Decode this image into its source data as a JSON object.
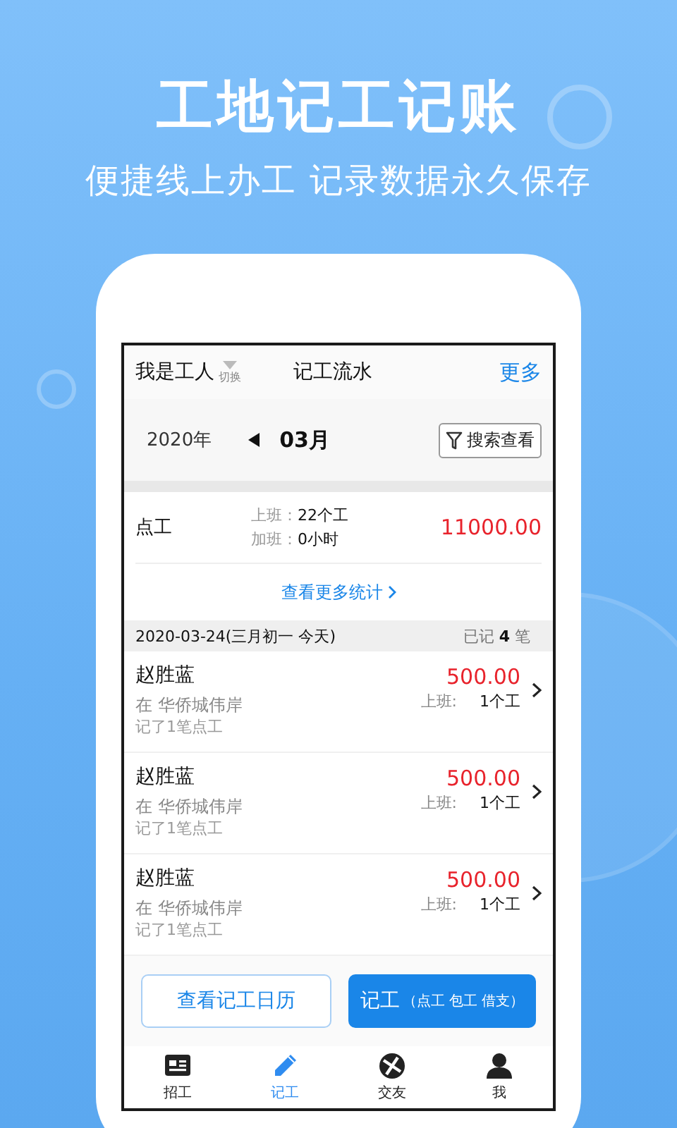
{
  "headline": "工地记工记账",
  "subheadline": "便捷线上办工 记录数据永久保存",
  "app": {
    "header": {
      "role": "我是工人",
      "switch": "切换",
      "title": "记工流水",
      "more": "更多"
    },
    "date_bar": {
      "year": "2020年",
      "month": "03月",
      "search": "搜索查看"
    },
    "summary": {
      "type": "点工",
      "rows": [
        {
          "label": "上班：",
          "value": "22个工"
        },
        {
          "label": "加班：",
          "value": "0小时"
        }
      ],
      "amount": "11000.00"
    },
    "more_stats": "查看更多统计",
    "day_header": {
      "date": "2020-03-24(三月初一 今天)",
      "count": "已记 **4** 笔"
    },
    "records": [
      {
        "name": "赵胜蓝",
        "place": "在 华侨城伟岸",
        "note": "记了1笔点工",
        "amount": "500.00",
        "shift_label": "上班:",
        "shift_value": "1个工"
      },
      {
        "name": "赵胜蓝",
        "place": "在 华侨城伟岸",
        "note": "记了1笔点工",
        "amount": "500.00",
        "shift_label": "上班:",
        "shift_value": "1个工"
      },
      {
        "name": "赵胜蓝",
        "place": "在 华侨城伟岸",
        "note": "记了1笔点工",
        "amount": "500.00",
        "shift_label": "上班:",
        "shift_value": "1个工"
      }
    ],
    "actions": [
      {
        "kind": "outline",
        "label": "查看记工日历"
      },
      {
        "kind": "primary",
        "label": "记工",
        "sub": "（点工 包工 借支）"
      }
    ],
    "tabs": [
      {
        "label": "招工",
        "selected": false
      },
      {
        "label": "记工",
        "selected": true
      },
      {
        "label": "交友",
        "selected": false
      },
      {
        "label": "我",
        "selected": false
      }
    ]
  }
}
